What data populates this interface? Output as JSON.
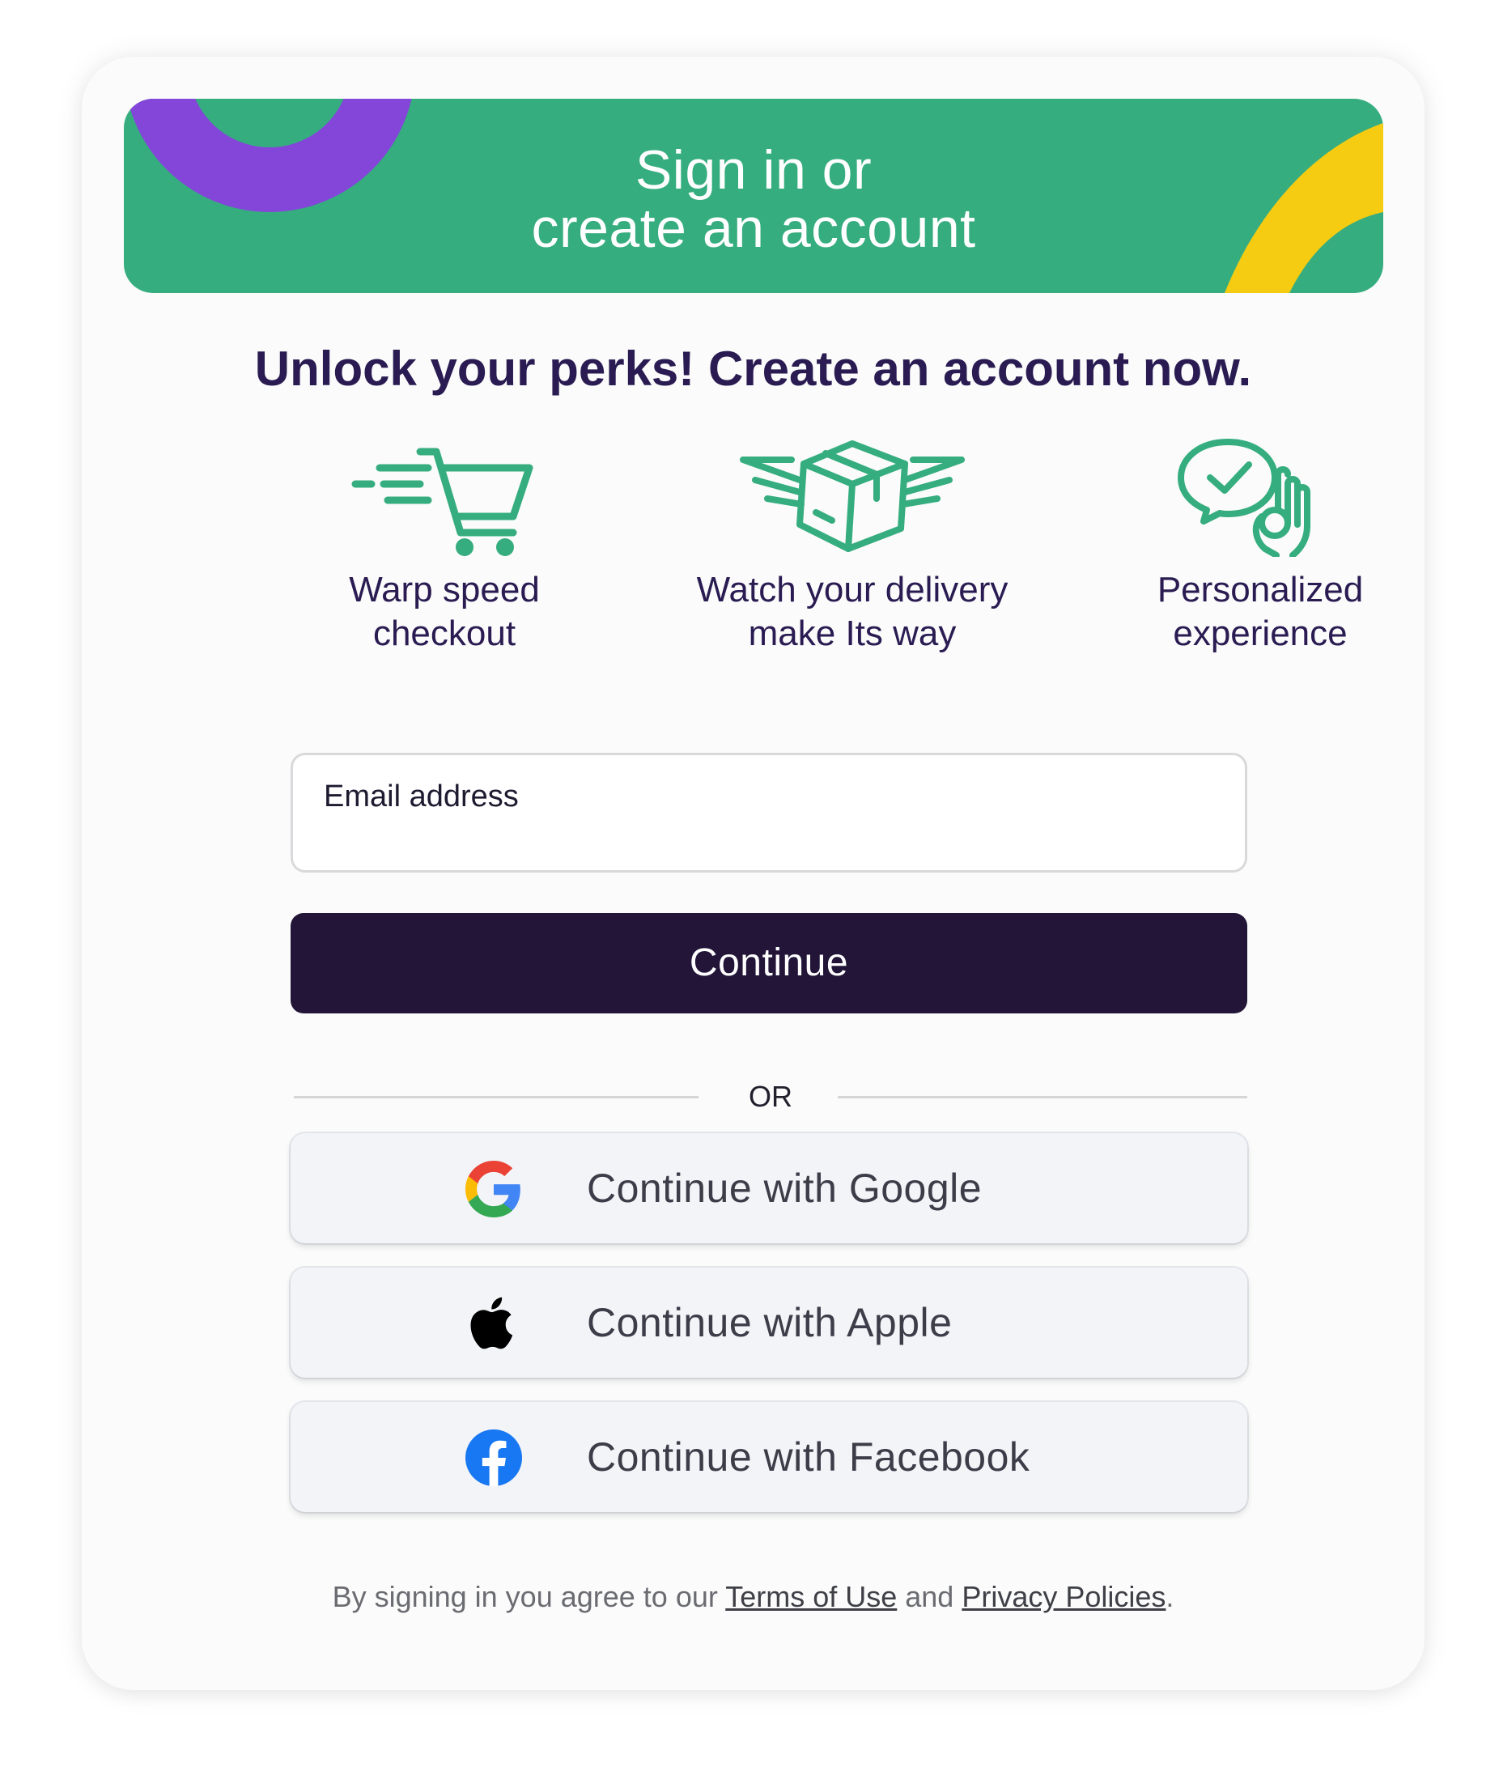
{
  "banner": {
    "title_line1": "Sign in or",
    "title_line2": "create an account"
  },
  "headline": "Unlock your perks! Create an account now.",
  "perks": [
    {
      "icon": "shopping-cart-icon",
      "line1": "Warp speed",
      "line2": "checkout"
    },
    {
      "icon": "winged-package-icon",
      "line1": "Watch your delivery",
      "line2": "make Its way"
    },
    {
      "icon": "chat-check-hand-ok-icon",
      "line1": "Personalized",
      "line2": "experience"
    }
  ],
  "email": {
    "label": "Email address",
    "value": ""
  },
  "continue_label": "Continue",
  "divider_text": "OR",
  "social": {
    "google_label": "Continue with Google",
    "apple_label": "Continue with Apple",
    "facebook_label": "Continue with Facebook"
  },
  "legal": {
    "prefix": "By signing in you agree to our ",
    "terms": "Terms of Use",
    "middle": " and ",
    "privacy": "Privacy Policies",
    "suffix": "."
  },
  "colors": {
    "banner_green": "#35ad7f",
    "banner_purple": "#8446d9",
    "banner_yellow": "#f6cc12",
    "icon_green": "#35ad7f",
    "headline_purple": "#2a1b52",
    "button_dark": "#221538",
    "facebook_blue": "#1877f2"
  }
}
